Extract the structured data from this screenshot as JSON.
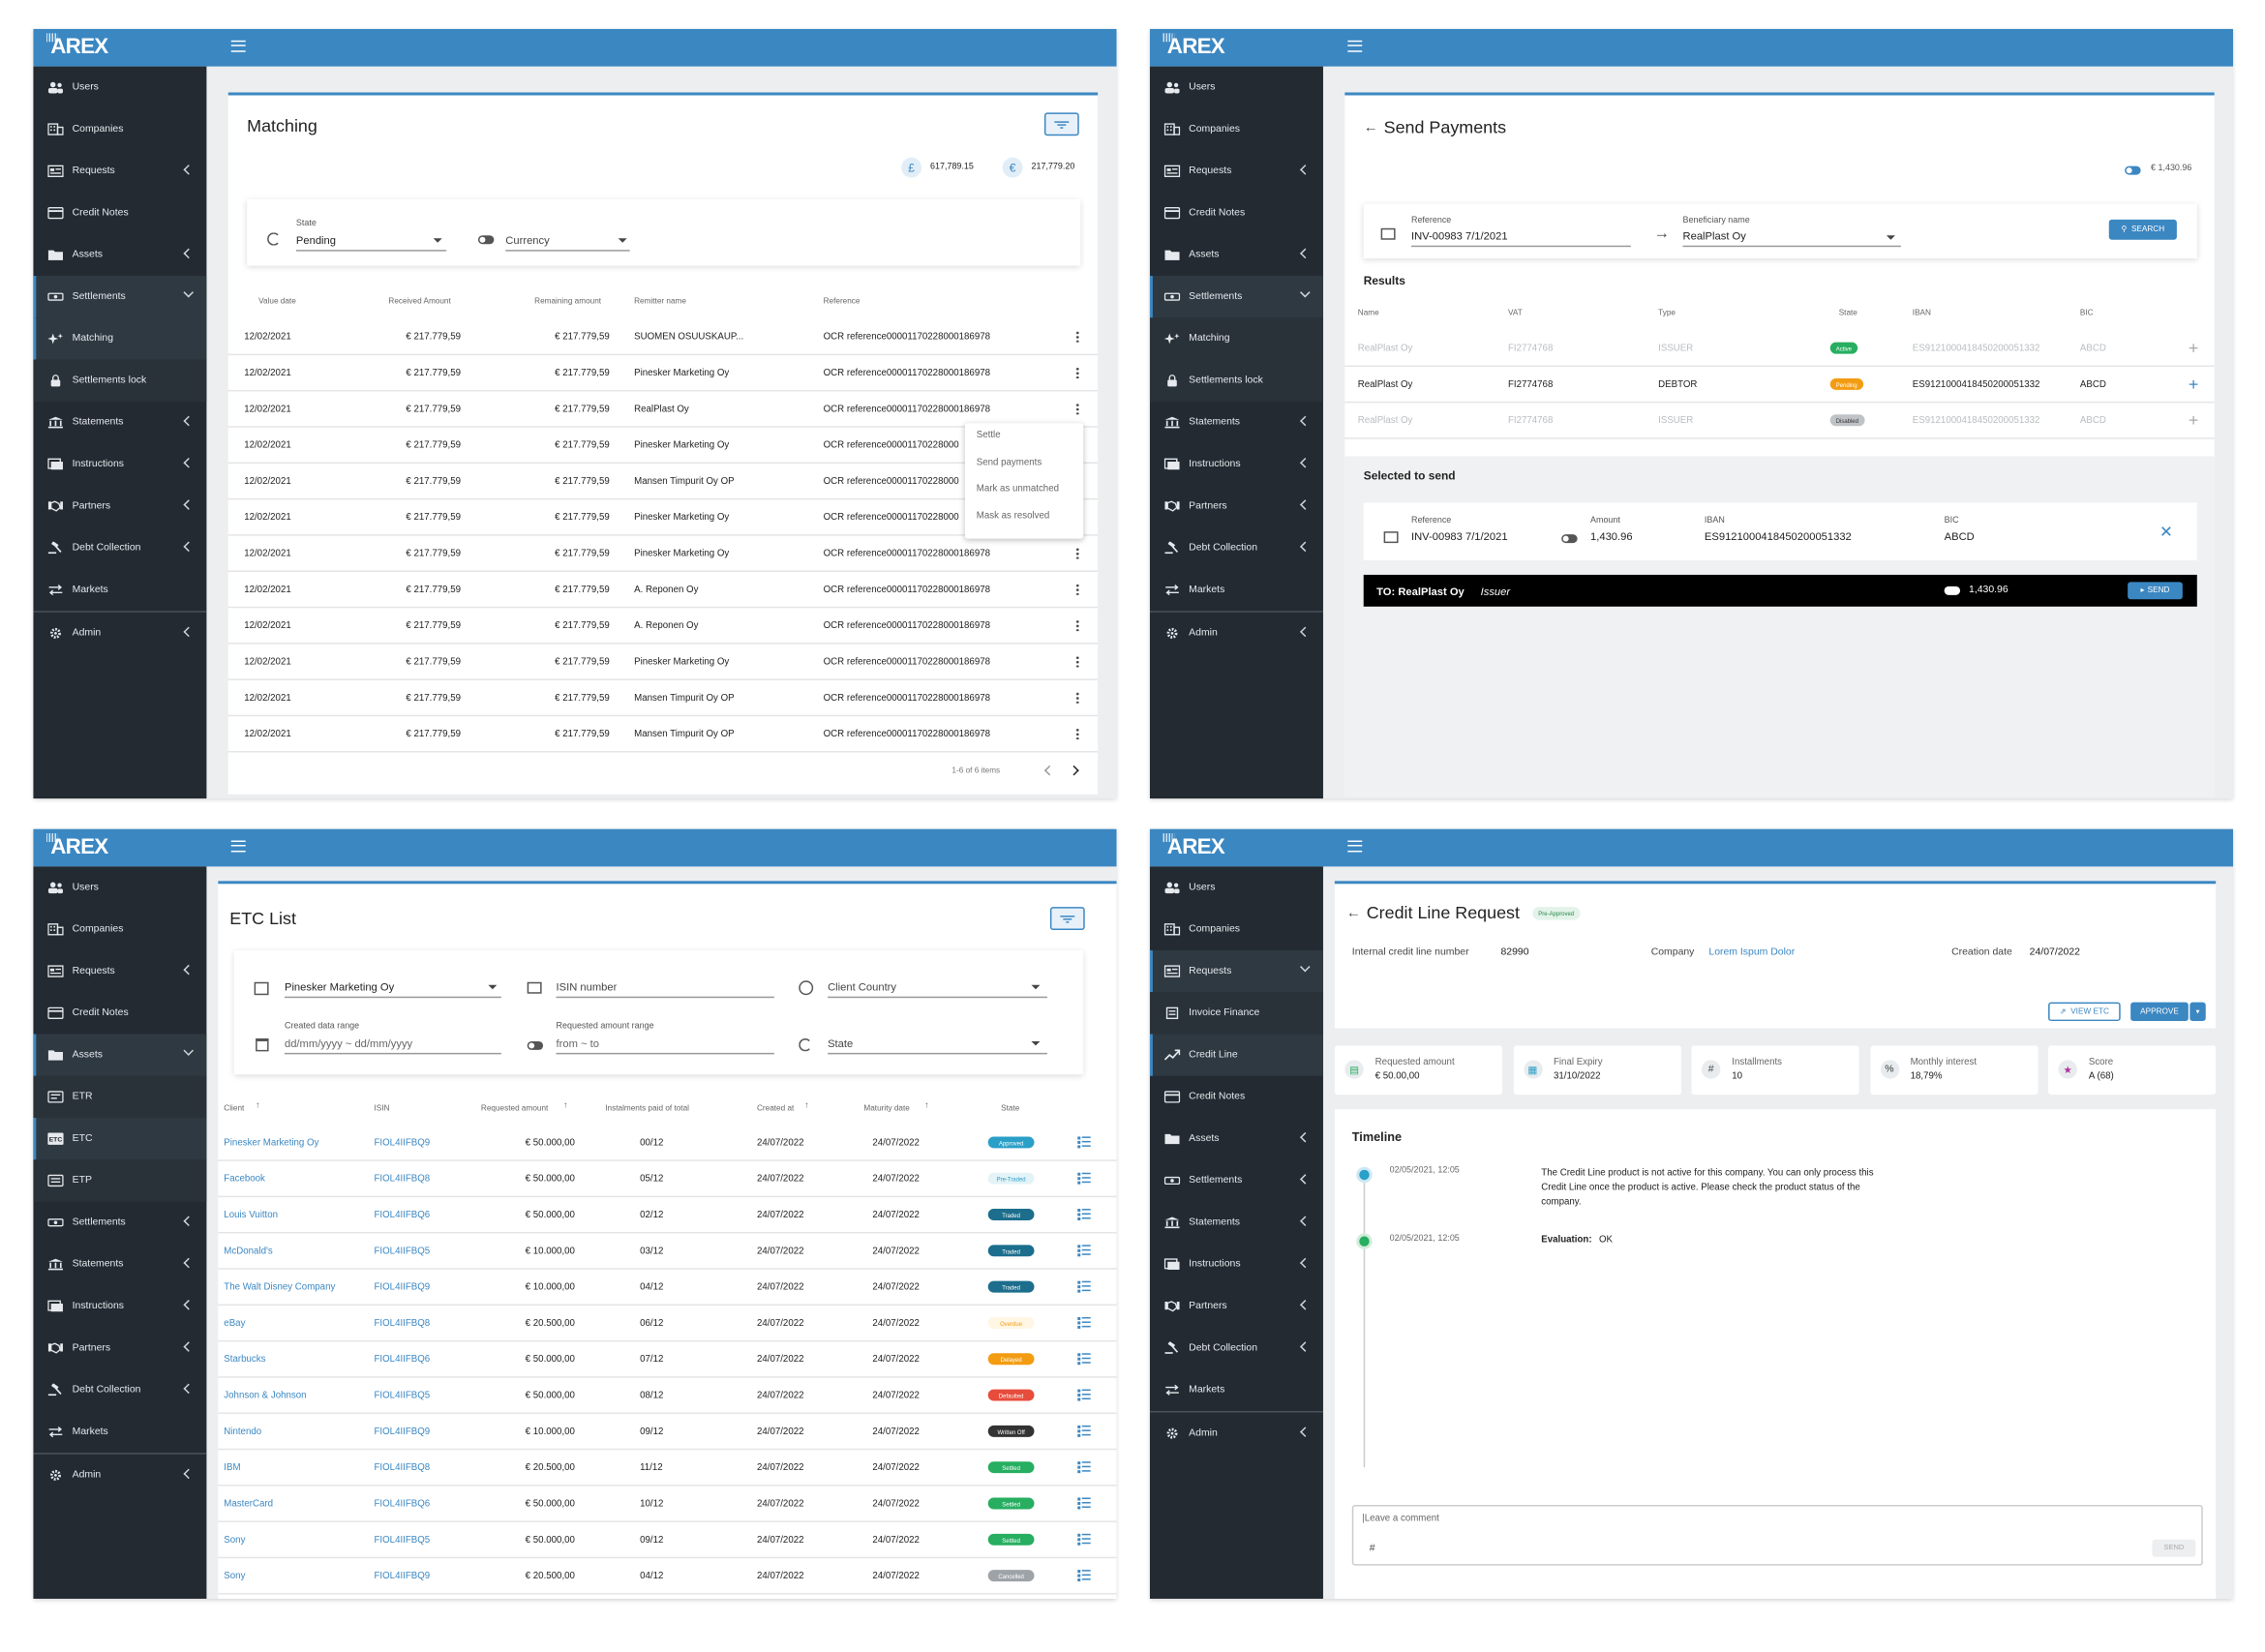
{
  "brand": "AREX",
  "colors": {
    "accent": "#3b87c2",
    "sidebar": "#232a31",
    "approved": "#2a9fc7",
    "traded": "#1c6e8c",
    "overdue": "#fff6e4",
    "delayed": "#f39c12",
    "defaulted": "#e74c3c",
    "written_off": "#333333",
    "settled": "#27ae60",
    "cancelled": "#9ea3a8",
    "active": "#27ae60",
    "pending": "#f39c12",
    "disabled": "#bfc3c7"
  },
  "nav": {
    "matching": [
      {
        "icon": "users-icon",
        "label": "Users"
      },
      {
        "icon": "companies-icon",
        "label": "Companies"
      },
      {
        "icon": "requests-icon",
        "label": "Requests",
        "chev": "left"
      },
      {
        "icon": "credit-notes-icon",
        "label": "Credit Notes"
      },
      {
        "icon": "folder-icon",
        "label": "Assets",
        "chev": "left"
      },
      {
        "icon": "settlements-icon",
        "label": "Settlements",
        "chev": "down",
        "active": true
      },
      {
        "icon": "sparkle-icon",
        "label": "Matching",
        "sub": true,
        "active": true
      },
      {
        "icon": "lock-icon",
        "label": "Settlements lock",
        "sub": true
      },
      {
        "icon": "bank-icon",
        "label": "Statements",
        "chev": "left"
      },
      {
        "icon": "instructions-icon",
        "label": "Instructions",
        "chev": "left"
      },
      {
        "icon": "partners-icon",
        "label": "Partners",
        "chev": "left"
      },
      {
        "icon": "gavel-icon",
        "label": "Debt Collection",
        "chev": "left"
      },
      {
        "icon": "swap-icon",
        "label": "Markets",
        "sep": true
      },
      {
        "icon": "gear-icon",
        "label": "Admin",
        "chev": "left"
      }
    ],
    "payments": [
      {
        "icon": "users-icon",
        "label": "Users"
      },
      {
        "icon": "companies-icon",
        "label": "Companies"
      },
      {
        "icon": "requests-icon",
        "label": "Requests",
        "chev": "left"
      },
      {
        "icon": "credit-notes-icon",
        "label": "Credit Notes"
      },
      {
        "icon": "folder-icon",
        "label": "Assets",
        "chev": "left"
      },
      {
        "icon": "settlements-icon",
        "label": "Settlements",
        "chev": "down",
        "active": true
      },
      {
        "icon": "sparkle-icon",
        "label": "Matching",
        "sub": true
      },
      {
        "icon": "lock-icon",
        "label": "Settlements lock",
        "sub": true
      },
      {
        "icon": "bank-icon",
        "label": "Statements",
        "chev": "left"
      },
      {
        "icon": "instructions-icon",
        "label": "Instructions",
        "chev": "left"
      },
      {
        "icon": "partners-icon",
        "label": "Partners",
        "chev": "left"
      },
      {
        "icon": "gavel-icon",
        "label": "Debt Collection",
        "chev": "left"
      },
      {
        "icon": "swap-icon",
        "label": "Markets",
        "sep": true
      },
      {
        "icon": "gear-icon",
        "label": "Admin",
        "chev": "left"
      }
    ],
    "etc": [
      {
        "icon": "users-icon",
        "label": "Users"
      },
      {
        "icon": "companies-icon",
        "label": "Companies"
      },
      {
        "icon": "requests-icon",
        "label": "Requests",
        "chev": "left"
      },
      {
        "icon": "credit-notes-icon",
        "label": "Credit Notes"
      },
      {
        "icon": "folder-icon",
        "label": "Assets",
        "chev": "down",
        "active": true
      },
      {
        "icon": "etr-icon",
        "label": "ETR",
        "sub": true
      },
      {
        "icon": "etc-icon",
        "label": "ETC",
        "sub": true,
        "active": true
      },
      {
        "icon": "etp-icon",
        "label": "ETP",
        "sub": true
      },
      {
        "icon": "settlements-icon",
        "label": "Settlements",
        "chev": "left"
      },
      {
        "icon": "bank-icon",
        "label": "Statements",
        "chev": "left"
      },
      {
        "icon": "instructions-icon",
        "label": "Instructions",
        "chev": "left"
      },
      {
        "icon": "partners-icon",
        "label": "Partners",
        "chev": "left"
      },
      {
        "icon": "gavel-icon",
        "label": "Debt Collection",
        "chev": "left"
      },
      {
        "icon": "swap-icon",
        "label": "Markets",
        "sep": true
      },
      {
        "icon": "gear-icon",
        "label": "Admin",
        "chev": "left"
      }
    ],
    "credit": [
      {
        "icon": "users-icon",
        "label": "Users"
      },
      {
        "icon": "companies-icon",
        "label": "Companies"
      },
      {
        "icon": "requests-icon",
        "label": "Requests",
        "chev": "down",
        "active": true
      },
      {
        "icon": "invoice-icon",
        "label": "Invoice Finance",
        "sub": true
      },
      {
        "icon": "trend-icon",
        "label": "Credit Line",
        "sub": true,
        "active": true
      },
      {
        "icon": "credit-notes-icon",
        "label": "Credit Notes"
      },
      {
        "icon": "folder-icon",
        "label": "Assets",
        "chev": "left"
      },
      {
        "icon": "settlements-icon",
        "label": "Settlements",
        "chev": "left"
      },
      {
        "icon": "bank-icon",
        "label": "Statements",
        "chev": "left"
      },
      {
        "icon": "instructions-icon",
        "label": "Instructions",
        "chev": "left"
      },
      {
        "icon": "partners-icon",
        "label": "Partners",
        "chev": "left"
      },
      {
        "icon": "gavel-icon",
        "label": "Debt Collection",
        "chev": "left"
      },
      {
        "icon": "swap-icon",
        "label": "Markets",
        "sep": true
      },
      {
        "icon": "gear-icon",
        "label": "Admin",
        "chev": "left"
      }
    ]
  },
  "matching": {
    "title": "Matching",
    "gbp_symbol": "£",
    "gbp_total": "617,789.15",
    "eur_symbol": "€",
    "eur_total": "217,779.20",
    "state_label": "State",
    "state_value": "Pending",
    "currency_label": "Currency",
    "columns": [
      "Value date",
      "Received Amount",
      "Remaining amount",
      "Remitter name",
      "Reference"
    ],
    "rows": [
      [
        "12/02/2021",
        "€ 217.779,59",
        "€ 217.779,59",
        "SUOMEN OSUUSKAUP...",
        "OCR reference00001170228000186978"
      ],
      [
        "12/02/2021",
        "€ 217.779,59",
        "€ 217.779,59",
        "Pinesker Marketing Oy",
        "OCR reference00001170228000186978"
      ],
      [
        "12/02/2021",
        "€ 217.779,59",
        "€ 217.779,59",
        "RealPlast Oy",
        "OCR reference00001170228000186978"
      ],
      [
        "12/02/2021",
        "€ 217.779,59",
        "€ 217.779,59",
        "Pinesker Marketing Oy",
        "OCR reference00001170228000"
      ],
      [
        "12/02/2021",
        "€ 217.779,59",
        "€ 217.779,59",
        "Mansen Timpurit Oy OP",
        "OCR reference00001170228000"
      ],
      [
        "12/02/2021",
        "€ 217.779,59",
        "€ 217.779,59",
        "Pinesker Marketing Oy",
        "OCR reference00001170228000"
      ],
      [
        "12/02/2021",
        "€ 217.779,59",
        "€ 217.779,59",
        "Pinesker Marketing Oy",
        "OCR reference00001170228000186978"
      ],
      [
        "12/02/2021",
        "€ 217.779,59",
        "€ 217.779,59",
        "A. Reponen Oy",
        "OCR reference00001170228000186978"
      ],
      [
        "12/02/2021",
        "€ 217.779,59",
        "€ 217.779,59",
        "A. Reponen Oy",
        "OCR reference00001170228000186978"
      ],
      [
        "12/02/2021",
        "€ 217.779,59",
        "€ 217.779,59",
        "Pinesker Marketing Oy",
        "OCR reference00001170228000186978"
      ],
      [
        "12/02/2021",
        "€ 217.779,59",
        "€ 217.779,59",
        "Mansen Timpurit Oy OP",
        "OCR reference00001170228000186978"
      ],
      [
        "12/02/2021",
        "€ 217.779,59",
        "€ 217.779,59",
        "Mansen Timpurit Oy OP",
        "OCR reference00001170228000186978"
      ]
    ],
    "menu": [
      "Settle",
      "Send payments",
      "Mark as unmatched",
      "Mask as resolved"
    ],
    "pagination": "1-6 of 6 items"
  },
  "payments": {
    "title": "Send Payments",
    "balance": "€ 1,430.96",
    "ref_label": "Reference",
    "ref_value": "INV-00983 7/1/2021",
    "benef_label": "Beneficiary name",
    "benef_value": "RealPlast Oy",
    "search": "SEARCH",
    "results": "Results",
    "columns": [
      "Name",
      "VAT",
      "Type",
      "State",
      "IBAN",
      "BIC"
    ],
    "rows": [
      {
        "name": "RealPlast Oy",
        "vat": "FI2774768",
        "type": "ISSUER",
        "state": "Active",
        "iban": "ES9121000418450200051332",
        "bic": "ABCD",
        "muted": true,
        "color": "active"
      },
      {
        "name": "RealPlast Oy",
        "vat": "FI2774768",
        "type": "DEBTOR",
        "state": "Pending",
        "iban": "ES9121000418450200051332",
        "bic": "ABCD",
        "muted": false,
        "color": "pending"
      },
      {
        "name": "RealPlast Oy",
        "vat": "FI2774768",
        "type": "ISSUER",
        "state": "Disabled",
        "iban": "ES9121000418450200051332",
        "bic": "ABCD",
        "muted": true,
        "color": "disabled"
      }
    ],
    "selected": "Selected to send",
    "sel_ref_label": "Reference",
    "sel_ref": "INV-00983 7/1/2021",
    "sel_amount_label": "Amount",
    "sel_amount": "1,430.96",
    "sel_iban_label": "IBAN",
    "sel_iban": "ES9121000418450200051332",
    "sel_bic_label": "BIC",
    "sel_bic": "ABCD",
    "to_label": "TO: RealPlast Oy",
    "to_type": "Issuer",
    "to_amount": "1,430.96",
    "send": "SEND"
  },
  "etc": {
    "title": "ETC List",
    "company": "Pinesker Marketing Oy",
    "isin_placeholder": "ISIN number",
    "country_placeholder": "Client Country",
    "date_label": "Created data range",
    "date_placeholder": "dd/mm/yyyy ~ dd/mm/yyyy",
    "amount_label": "Requested amount range",
    "amount_placeholder": "from ~ to",
    "state_placeholder": "State",
    "columns": [
      "Client",
      "ISIN",
      "Requested amount",
      "Instalments paid of total",
      "Created at",
      "Maturity date",
      "State"
    ],
    "rows": [
      [
        "Pinesker Marketing Oy",
        "FIOL4IIFBQ9",
        "€ 50.000,00",
        "00/12",
        "24/07/2022",
        "24/07/2022",
        "Approved",
        "approved"
      ],
      [
        "Facebook",
        "FIOL4IIFBQ8",
        "€ 50.000,00",
        "05/12",
        "24/07/2022",
        "24/07/2022",
        "Pre-Traded",
        "pretraded"
      ],
      [
        "Louis Vuitton",
        "FIOL4IIFBQ6",
        "€ 50.000,00",
        "02/12",
        "24/07/2022",
        "24/07/2022",
        "Traded",
        "traded"
      ],
      [
        "McDonald's",
        "FIOL4IIFBQ5",
        "€ 10.000,00",
        "03/12",
        "24/07/2022",
        "24/07/2022",
        "Traded",
        "traded"
      ],
      [
        "The Walt Disney Company",
        "FIOL4IIFBQ9",
        "€ 10.000,00",
        "04/12",
        "24/07/2022",
        "24/07/2022",
        "Traded",
        "traded"
      ],
      [
        "eBay",
        "FIOL4IIFBQ8",
        "€ 20.500,00",
        "06/12",
        "24/07/2022",
        "24/07/2022",
        "Overdue",
        "overdue"
      ],
      [
        "Starbucks",
        "FIOL4IIFBQ6",
        "€ 50.000,00",
        "07/12",
        "24/07/2022",
        "24/07/2022",
        "Delayed",
        "delayed"
      ],
      [
        "Johnson & Johnson",
        "FIOL4IIFBQ5",
        "€ 50.000,00",
        "08/12",
        "24/07/2022",
        "24/07/2022",
        "Defaulted",
        "defaulted"
      ],
      [
        "Nintendo",
        "FIOL4IIFBQ9",
        "€ 10.000,00",
        "09/12",
        "24/07/2022",
        "24/07/2022",
        "Written Off",
        "written_off"
      ],
      [
        "IBM",
        "FIOL4IIFBQ8",
        "€ 20.500,00",
        "11/12",
        "24/07/2022",
        "24/07/2022",
        "Settled",
        "settled"
      ],
      [
        "MasterCard",
        "FIOL4IIFBQ6",
        "€ 50.000,00",
        "10/12",
        "24/07/2022",
        "24/07/2022",
        "Settled",
        "settled"
      ],
      [
        "Sony",
        "FIOL4IIFBQ5",
        "€ 50.000,00",
        "09/12",
        "24/07/2022",
        "24/07/2022",
        "Settled",
        "settled"
      ],
      [
        "Sony",
        "FIOL4IIFBQ9",
        "€ 20.500,00",
        "04/12",
        "24/07/2022",
        "24/07/2022",
        "Cancelled",
        "cancelled"
      ]
    ]
  },
  "credit": {
    "title": "Credit Line Request",
    "badge": "Pre-Approved",
    "icl_label": "Internal credit line number",
    "icl": "82990",
    "company_label": "Company",
    "company": "Lorem Ispum Dolor",
    "date_label": "Creation date",
    "date": "24/07/2022",
    "view_etc": "VIEW ETC",
    "approve": "APPROVE",
    "stats": [
      {
        "icon": "cash-icon",
        "label": "Requested amount",
        "value": "€ 50.00,00"
      },
      {
        "icon": "calendar-icon",
        "label": "Final Expiry",
        "value": "31/10/2022"
      },
      {
        "icon": "hash-icon",
        "label": "Installments",
        "value": "10"
      },
      {
        "icon": "percent-icon",
        "label": "Monthly interest",
        "value": "18,79%"
      },
      {
        "icon": "star-icon",
        "label": "Score",
        "value": "A (68)"
      }
    ],
    "timeline_title": "Timeline",
    "t1_date": "02/05/2021, 12:05",
    "t1_text": "The Credit Line product is not active for this company. You can only process this Credit Line once the product is active. Please check the product status of the company.",
    "t2_date": "02/05/2021, 12:05",
    "t2_label": "Evaluation:",
    "t2_value": "OK",
    "comment_placeholder": "|Leave a comment",
    "comment_send": "SEND"
  }
}
